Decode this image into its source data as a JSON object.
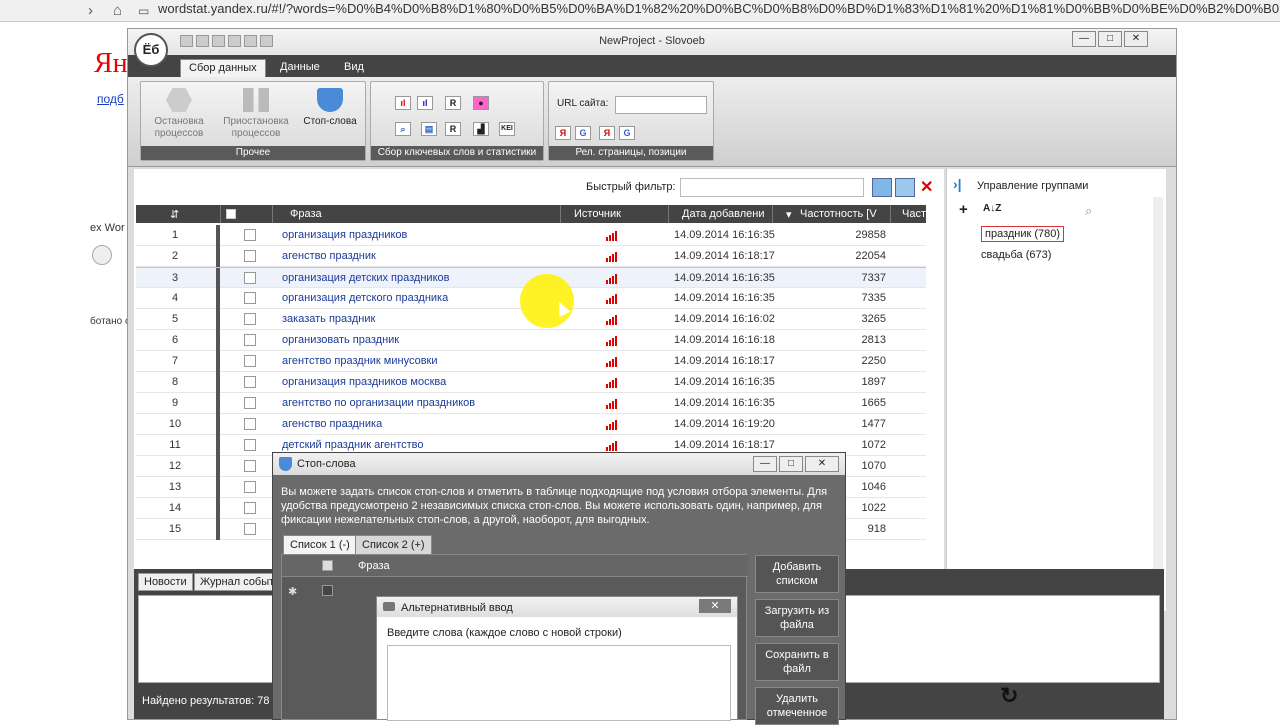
{
  "browser": {
    "url": "wordstat.yandex.ru/#!/?words=%D0%B4%D0%B8%D1%80%D0%B5%D0%BA%D1%82%20%D0%BC%D0%B8%D0%BD%D1%83%D1%81%20%D1%81%D0%BB%D0%BE%D0%B2%D0%B0"
  },
  "background_page": {
    "logo": "Ян",
    "link": "подб",
    "text1": "ex Wor",
    "text2": "ботано с"
  },
  "window": {
    "title": "NewProject - Slovoeb",
    "logo": "Ёб",
    "controls": [
      "—",
      "□",
      "✕"
    ]
  },
  "ribbon": {
    "tabs": [
      "Сбор данных",
      "Данные",
      "Вид"
    ],
    "active_tab": 0,
    "groups": [
      {
        "label": "Прочее",
        "buttons": [
          "Остановка процессов",
          "Приостановка процессов",
          "Стоп-слова"
        ]
      },
      {
        "label": "Сбор ключевых слов и статистики"
      },
      {
        "label": "Рел. страницы, позиции",
        "url_label": "URL сайта:"
      }
    ]
  },
  "table": {
    "filter_label": "Быстрый фильтр:",
    "headers": [
      "Фраза",
      "Источник",
      "Дата добавлени",
      "Частотность [V",
      "Част"
    ],
    "rows": [
      {
        "num": "1",
        "phrase": "организация праздников",
        "date": "14.09.2014 16:16:35",
        "freq": "29858"
      },
      {
        "num": "2",
        "phrase": "агенство праздник",
        "date": "14.09.2014 16:18:17",
        "freq": "22054"
      },
      {
        "num": "3",
        "phrase": "организация детских праздников",
        "date": "14.09.2014 16:16:35",
        "freq": "7337"
      },
      {
        "num": "4",
        "phrase": "организация детского праздника",
        "date": "14.09.2014 16:16:35",
        "freq": "7335"
      },
      {
        "num": "5",
        "phrase": "заказать праздник",
        "date": "14.09.2014 16:16:02",
        "freq": "3265"
      },
      {
        "num": "6",
        "phrase": "организовать праздник",
        "date": "14.09.2014 16:16:18",
        "freq": "2813"
      },
      {
        "num": "7",
        "phrase": "агентство праздник минусовки",
        "date": "14.09.2014 16:18:17",
        "freq": "2250"
      },
      {
        "num": "8",
        "phrase": "организация праздников москва",
        "date": "14.09.2014 16:16:35",
        "freq": "1897"
      },
      {
        "num": "9",
        "phrase": "агентство по организации праздников",
        "date": "14.09.2014 16:16:35",
        "freq": "1665"
      },
      {
        "num": "10",
        "phrase": "агенство праздника",
        "date": "14.09.2014 16:19:20",
        "freq": "1477"
      },
      {
        "num": "11",
        "phrase": "детский праздник агентство",
        "date": "14.09.2014 16:18:17",
        "freq": "1072"
      },
      {
        "num": "12",
        "phrase": "",
        "date": "",
        "freq": "1070"
      },
      {
        "num": "13",
        "phrase": "",
        "date": "",
        "freq": "1046"
      },
      {
        "num": "14",
        "phrase": "",
        "date": "",
        "freq": "1022"
      },
      {
        "num": "15",
        "phrase": "",
        "date": "",
        "freq": "918"
      }
    ],
    "selected_row": 2
  },
  "groups_panel": {
    "title": "Управление группами",
    "items": [
      "праздник (780)",
      "свадьба (673)"
    ],
    "selected": 0
  },
  "bottom_panel": {
    "tabs": [
      "Новости",
      "Журнал событ"
    ],
    "found_label": "Найдено результатов:  78"
  },
  "stop_dialog": {
    "title": "Стоп-слова",
    "description": "Вы можете задать список стоп-слов и отметить в таблице подходящие под условия отбора элементы. Для удобства предусмотрено 2 независимых списка стоп-слов. Вы можете использовать один, например, для фиксации нежелательных стоп-слов, а другой, наоборот, для выгодных.",
    "tabs": [
      "Список 1 (-)",
      "Список 2 (+)"
    ],
    "grid_header": "Фраза",
    "buttons": [
      "Добавить списком",
      "Загрузить из файла",
      "Сохранить в файл",
      "Удалить отмеченное"
    ]
  },
  "alt_dialog": {
    "title": "Альтернативный ввод",
    "label": "Введите слова (каждое слово с новой строки)",
    "value": ""
  }
}
